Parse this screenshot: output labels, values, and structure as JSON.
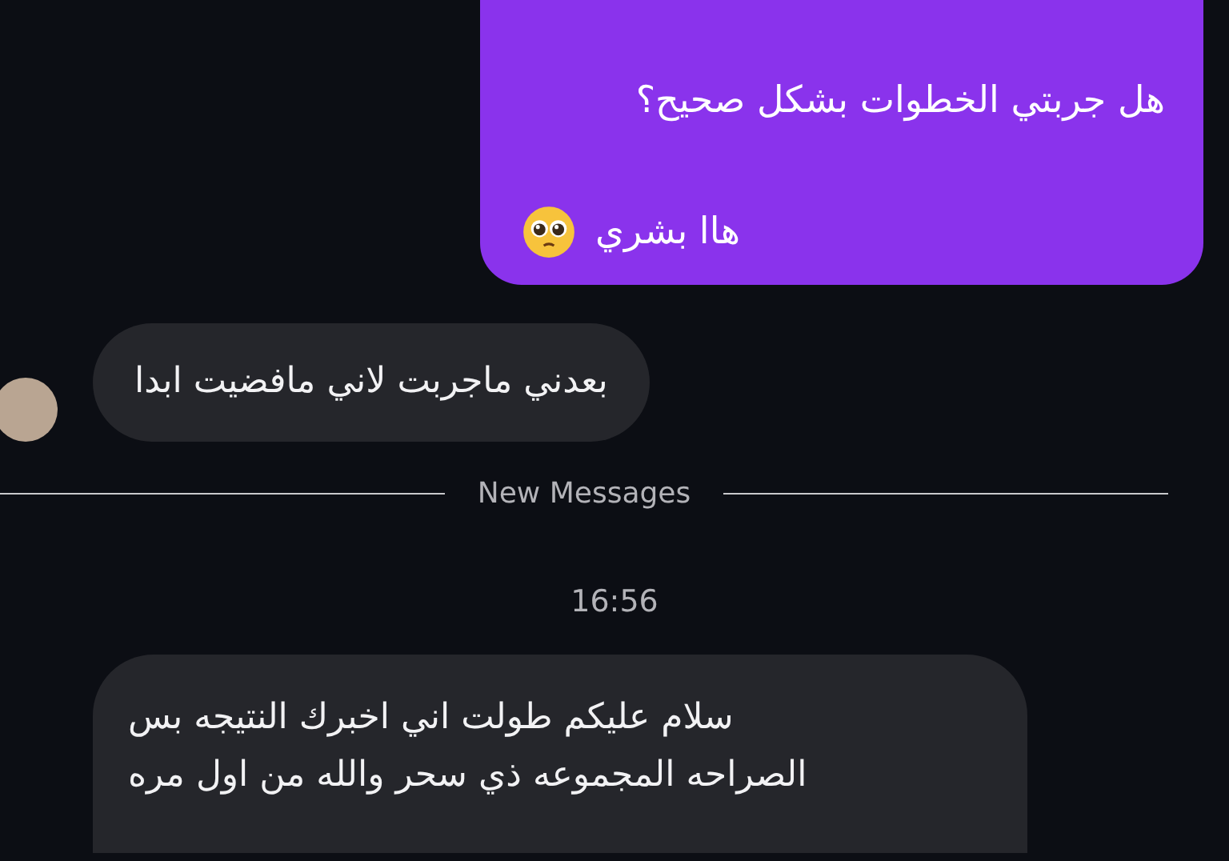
{
  "messages": [
    {
      "kind": "outgoing",
      "lines": [
        "هل جربتي الخطوات بشكل صحيح؟",
        "هاا بشري"
      ],
      "emoji": true
    },
    {
      "kind": "incoming",
      "avatar": true,
      "lines": [
        "بعدني ماجربت لاني مافضيت ابدا"
      ]
    },
    {
      "kind": "divider",
      "label": "New Messages"
    },
    {
      "kind": "time",
      "label": "16:56"
    },
    {
      "kind": "incoming_long",
      "avatar": false,
      "lines": [
        "سلام عليكم طولت اني اخبرك النتيجه بس الصراحه المجموعه ذي سحر والله من اول مره"
      ]
    }
  ]
}
